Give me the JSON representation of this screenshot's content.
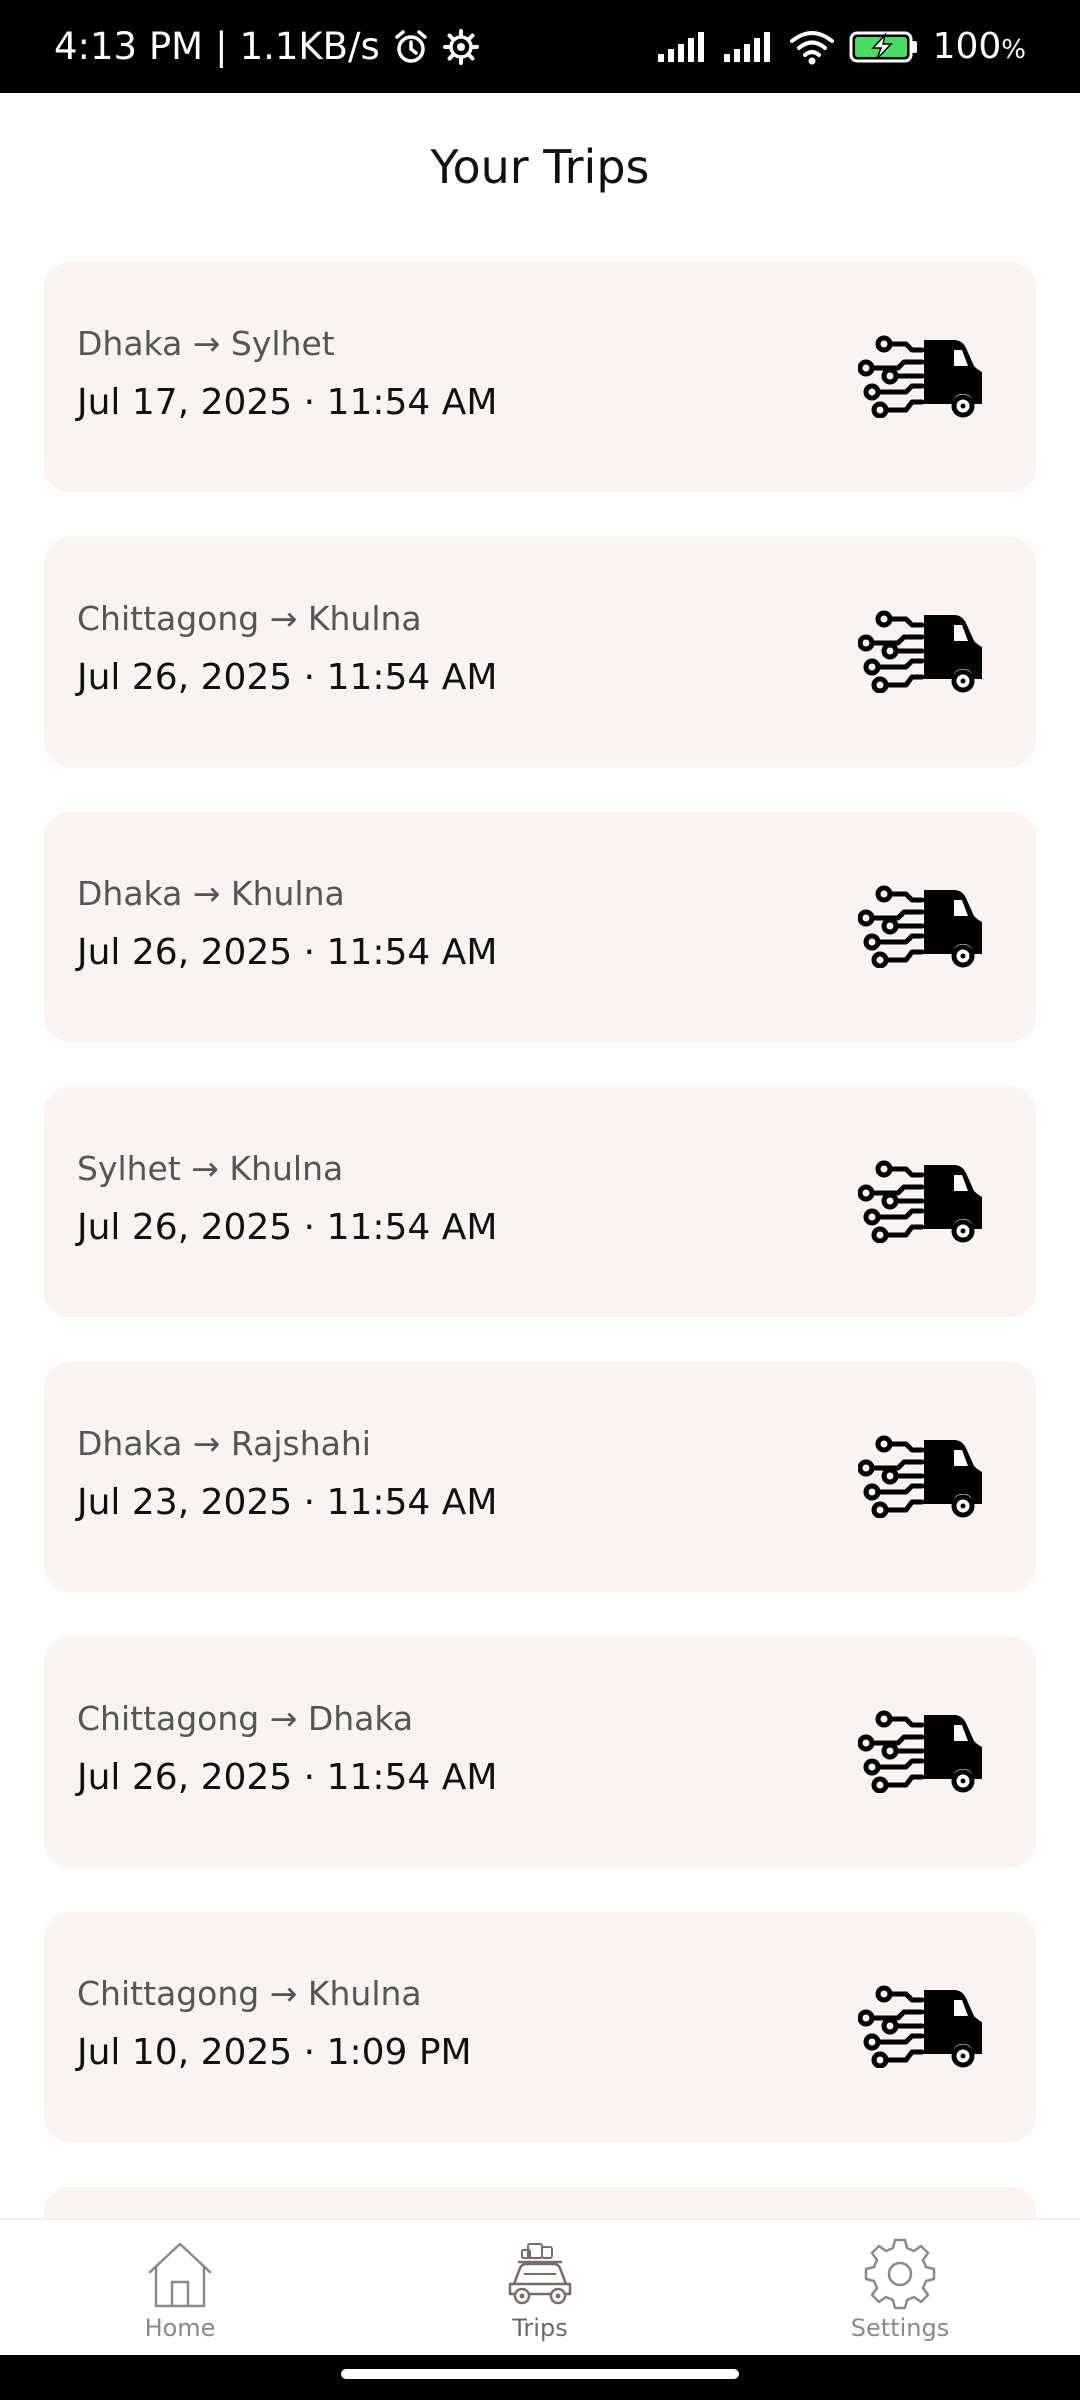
{
  "status_bar": {
    "time": "4:13 PM",
    "separator": "|",
    "net_speed": "1.1KB/s",
    "battery_percent": "100",
    "battery_sign": "%",
    "icons": [
      "alarm-icon",
      "settings-gear-icon",
      "signal-icon",
      "signal-icon",
      "wifi-icon",
      "battery-charging-icon"
    ]
  },
  "page": {
    "title": "Your Trips"
  },
  "trips": [
    {
      "route": "Dhaka → Sylhet",
      "date": "Jul 17, 2025",
      "dot": "·",
      "time": "11:54 AM"
    },
    {
      "route": "Chittagong → Khulna",
      "date": "Jul 26, 2025",
      "dot": "·",
      "time": "11:54 AM"
    },
    {
      "route": "Dhaka → Khulna",
      "date": "Jul 26, 2025",
      "dot": "·",
      "time": "11:54 AM"
    },
    {
      "route": "Sylhet → Khulna",
      "date": "Jul 26, 2025",
      "dot": "·",
      "time": "11:54 AM"
    },
    {
      "route": "Dhaka → Rajshahi",
      "date": "Jul 23, 2025",
      "dot": "·",
      "time": "11:54 AM"
    },
    {
      "route": "Chittagong → Dhaka",
      "date": "Jul 26, 2025",
      "dot": "·",
      "time": "11:54 AM"
    },
    {
      "route": "Chittagong → Khulna",
      "date": "Jul 10, 2025",
      "dot": "·",
      "time": "1:09 PM"
    }
  ],
  "nav": {
    "items": [
      {
        "label": "Home",
        "icon": "home-icon"
      },
      {
        "label": "Trips",
        "icon": "car-luggage-icon",
        "active": true
      },
      {
        "label": "Settings",
        "icon": "gear-icon"
      }
    ]
  },
  "colors": {
    "card_bg": "#fbf3f1",
    "title": "#111111",
    "route_text": "#555555",
    "nav_label": "#8a8a8a"
  }
}
